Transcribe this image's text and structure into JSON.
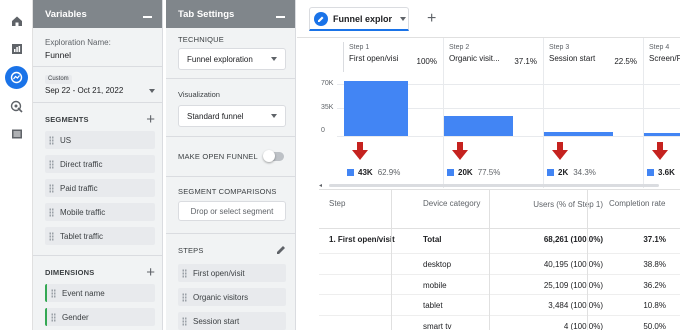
{
  "variables": {
    "header": "Variables",
    "exploration_label": "Exploration Name:",
    "exploration_name": "Funnel",
    "date_badge": "Custom",
    "date_range": "Sep 22 - Oct 21, 2022",
    "segments_label": "SEGMENTS",
    "segments": [
      "US",
      "Direct traffic",
      "Paid traffic",
      "Mobile traffic",
      "Tablet traffic"
    ],
    "dimensions_label": "DIMENSIONS",
    "dimensions": [
      "Event name",
      "Gender"
    ]
  },
  "tab_settings": {
    "header": "Tab Settings",
    "technique_label": "TECHNIQUE",
    "technique_value": "Funnel exploration",
    "visualization_label": "Visualization",
    "visualization_value": "Standard funnel",
    "open_funnel_label": "MAKE OPEN FUNNEL",
    "open_funnel_on": false,
    "segment_comparisons_label": "SEGMENT COMPARISONS",
    "segment_drop_placeholder": "Drop or select segment",
    "steps_label": "STEPS",
    "steps": [
      "First open/visit",
      "Organic visitors",
      "Session start"
    ]
  },
  "main": {
    "tab_label": "Funnel explor",
    "accent_color": "#1a73e8"
  },
  "chart_data": {
    "type": "bar",
    "ytick_labels": [
      "70K",
      "35K",
      "0"
    ],
    "ylim": [
      0,
      70000
    ],
    "steps": [
      {
        "num": "Step 1",
        "name": "First open/visi",
        "pct": "100%",
        "value": 68261
      },
      {
        "num": "Step 2",
        "name": "Organic visit...",
        "pct": "37.1%",
        "value": 25300
      },
      {
        "num": "Step 3",
        "name": "Session start",
        "pct": "22.5%",
        "value": 5600
      },
      {
        "num": "Step 4",
        "name": "Screen/F",
        "pct": "",
        "value": 3500
      }
    ],
    "dropoffs": [
      {
        "count": "43K",
        "pct": "62.9%"
      },
      {
        "count": "20K",
        "pct": "77.5%"
      },
      {
        "count": "2K",
        "pct": "34.3%"
      },
      {
        "count": "3.6K",
        "pct": ""
      }
    ],
    "bar_color": "#4285f4",
    "drop_color": "#c5221f"
  },
  "table": {
    "headers": [
      "Step",
      "Device category",
      "Users (% of Step 1)",
      "Completion rate"
    ],
    "rows": [
      {
        "step": "1. First open/visit",
        "device": "Total",
        "users": "68,261 (100.0%)",
        "rate": "37.1%"
      },
      {
        "step": "",
        "device": "desktop",
        "users": "40,195 (100.0%)",
        "rate": "38.8%"
      },
      {
        "step": "",
        "device": "mobile",
        "users": "25,109 (100.0%)",
        "rate": "36.2%"
      },
      {
        "step": "",
        "device": "tablet",
        "users": "3,484 (100.0%)",
        "rate": "10.8%"
      },
      {
        "step": "",
        "device": "smart tv",
        "users": "4 (100.0%)",
        "rate": "50.0%"
      }
    ]
  }
}
